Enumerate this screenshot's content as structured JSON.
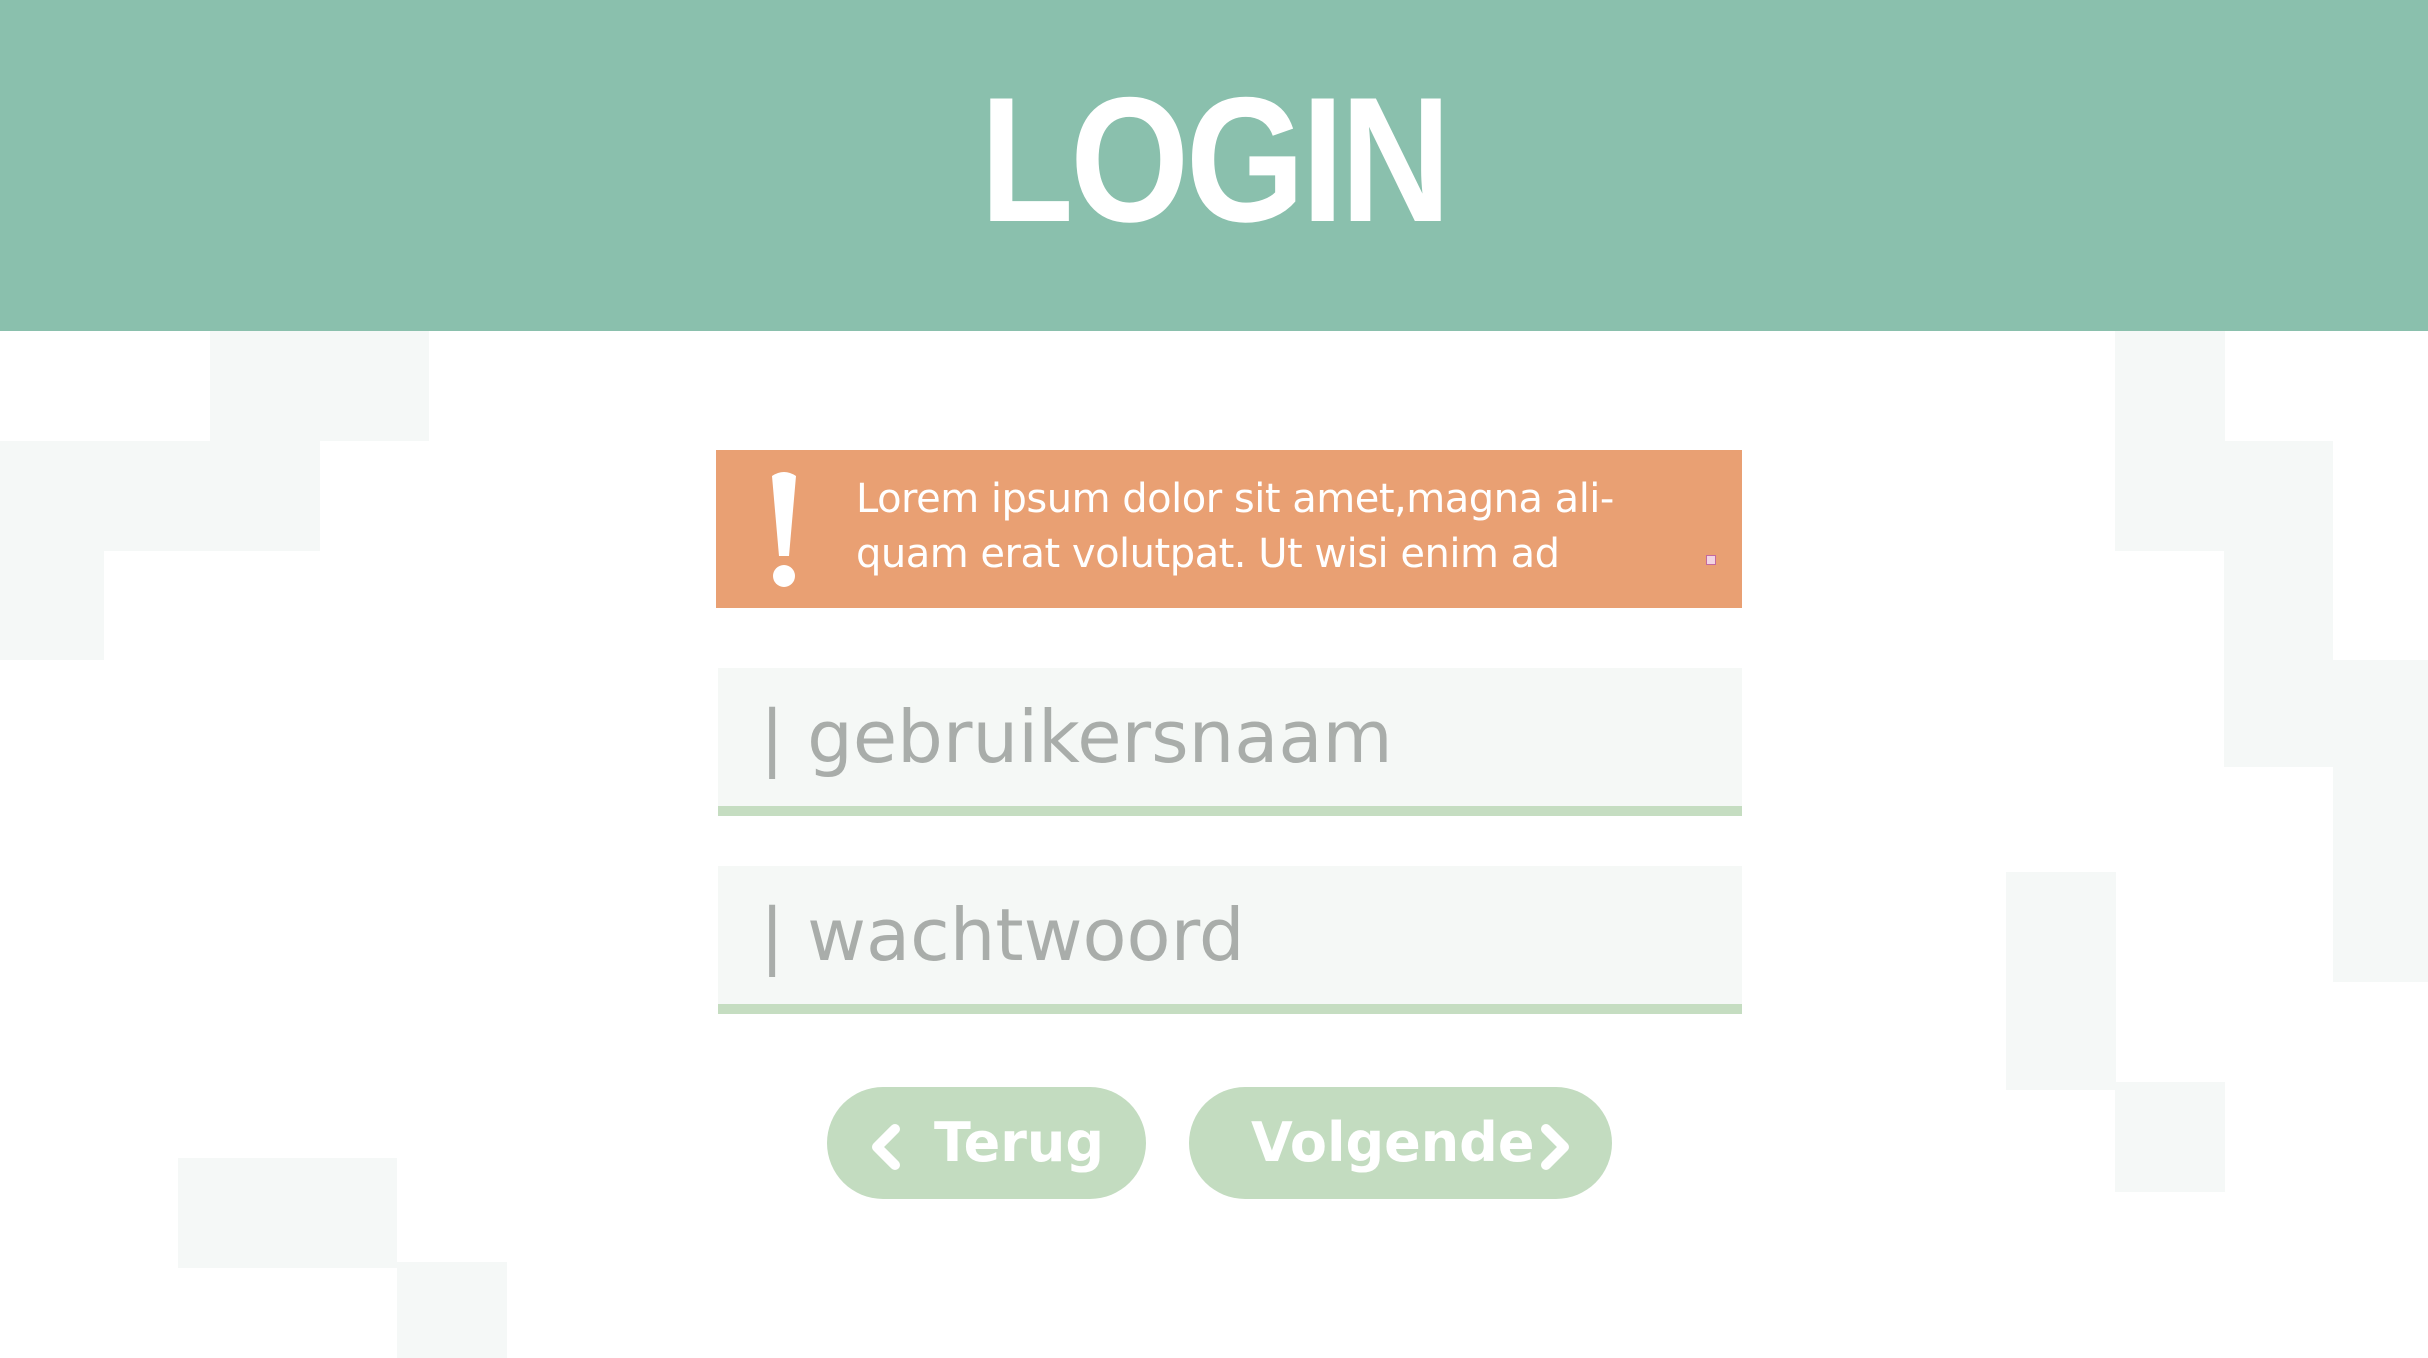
{
  "header": {
    "title": "LOGIN"
  },
  "alert": {
    "icon": "exclamation-icon",
    "message_line1": "Lorem ipsum dolor sit amet,magna ali-",
    "message_line2": "quam erat volutpat. Ut wisi enim ad"
  },
  "form": {
    "username": {
      "placeholder": "| gebruikersnaam",
      "value": ""
    },
    "password": {
      "placeholder": "| wachtwoord",
      "value": ""
    }
  },
  "buttons": {
    "back": {
      "label": "Terug",
      "icon": "chevron-left-icon"
    },
    "next": {
      "label": "Volgende",
      "icon": "chevron-right-icon"
    }
  },
  "colors": {
    "header": "#8ac0ad",
    "alert": "#e9a073",
    "field_background": "#f5f8f6",
    "field_underline": "#c5ddc1",
    "button": "#c3dcc0",
    "background_blocks": "#f5f8f7"
  }
}
